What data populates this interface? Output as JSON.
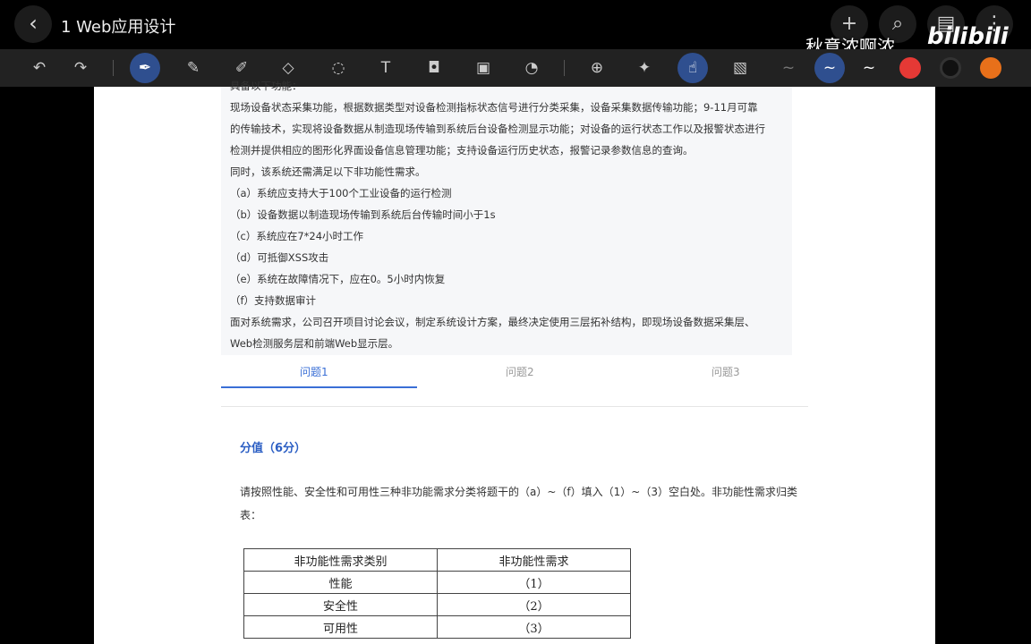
{
  "header": {
    "back_icon": "chevron-left-icon",
    "title": "1 Web应用设计",
    "watermark": "秋意浓啊浓",
    "logo": "bilibili"
  },
  "toolbar": {
    "colors": [
      "#e53935",
      "#111111",
      "#e8701a"
    ]
  },
  "desc": {
    "lines": [
      "具备以下功能：",
      "现场设备状态采集功能，根据数据类型对设备检测指标状态信号进行分类采集，设备采集数据传输功能；9-11月可靠",
      "的传输技术，实现将设备数据从制造现场传输到系统后台设备检测显示功能；对设备的运行状态工作以及报警状态进行",
      "检测并提供相应的图形化界面设备信息管理功能；支持设备运行历史状态，报警记录参数信息的查询。",
      "同时，该系统还需满足以下非功能性需求。",
      "（a）系统应支持大于100个工业设备的运行检测",
      "（b）设备数据以制造现场传输到系统后台传输时间小于1s",
      "（c）系统应在7*24小时工作",
      "（d）可抵御XSS攻击",
      "（e）系统在故障情况下，应在0。5小时内恢复",
      "（f）支持数据审计",
      "面对系统需求，公司召开项目讨论会议，制定系统设计方案，最终决定使用三层拓补结构，即现场设备数据采集层、",
      "Web检测服务层和前端Web显示层。"
    ]
  },
  "tabs": [
    "问题1",
    "问题2",
    "问题3"
  ],
  "score": "分值（6分）",
  "question": "请按照性能、安全性和可用性三种非功能需求分类将题干的（a）~（f）填入（1）~（3）空白处。非功能性需求归类表：",
  "table": {
    "headers": [
      "非功能性需求类别",
      "非功能性需求"
    ],
    "rows": [
      [
        "性能",
        "（1）"
      ],
      [
        "安全性",
        "（2）"
      ],
      [
        "可用性",
        "（3）"
      ]
    ]
  }
}
